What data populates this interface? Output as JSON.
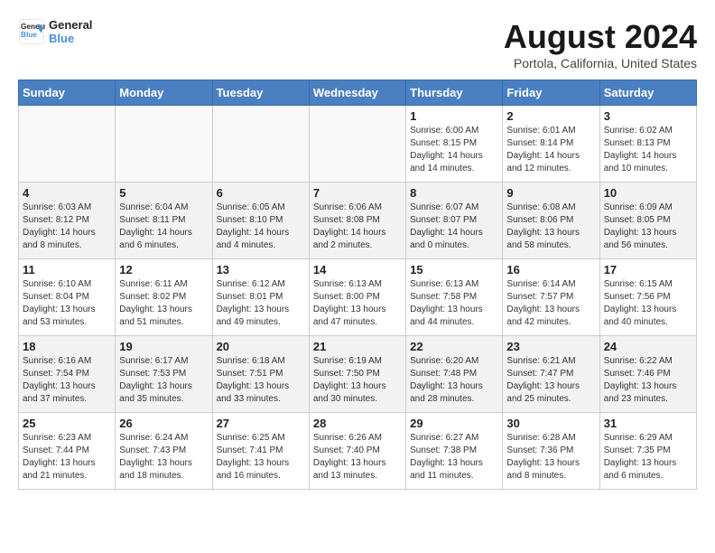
{
  "logo": {
    "line1": "General",
    "line2": "Blue"
  },
  "title": "August 2024",
  "location": "Portola, California, United States",
  "weekdays": [
    "Sunday",
    "Monday",
    "Tuesday",
    "Wednesday",
    "Thursday",
    "Friday",
    "Saturday"
  ],
  "weeks": [
    [
      {
        "day": "",
        "info": ""
      },
      {
        "day": "",
        "info": ""
      },
      {
        "day": "",
        "info": ""
      },
      {
        "day": "",
        "info": ""
      },
      {
        "day": "1",
        "info": "Sunrise: 6:00 AM\nSunset: 8:15 PM\nDaylight: 14 hours\nand 14 minutes."
      },
      {
        "day": "2",
        "info": "Sunrise: 6:01 AM\nSunset: 8:14 PM\nDaylight: 14 hours\nand 12 minutes."
      },
      {
        "day": "3",
        "info": "Sunrise: 6:02 AM\nSunset: 8:13 PM\nDaylight: 14 hours\nand 10 minutes."
      }
    ],
    [
      {
        "day": "4",
        "info": "Sunrise: 6:03 AM\nSunset: 8:12 PM\nDaylight: 14 hours\nand 8 minutes."
      },
      {
        "day": "5",
        "info": "Sunrise: 6:04 AM\nSunset: 8:11 PM\nDaylight: 14 hours\nand 6 minutes."
      },
      {
        "day": "6",
        "info": "Sunrise: 6:05 AM\nSunset: 8:10 PM\nDaylight: 14 hours\nand 4 minutes."
      },
      {
        "day": "7",
        "info": "Sunrise: 6:06 AM\nSunset: 8:08 PM\nDaylight: 14 hours\nand 2 minutes."
      },
      {
        "day": "8",
        "info": "Sunrise: 6:07 AM\nSunset: 8:07 PM\nDaylight: 14 hours\nand 0 minutes."
      },
      {
        "day": "9",
        "info": "Sunrise: 6:08 AM\nSunset: 8:06 PM\nDaylight: 13 hours\nand 58 minutes."
      },
      {
        "day": "10",
        "info": "Sunrise: 6:09 AM\nSunset: 8:05 PM\nDaylight: 13 hours\nand 56 minutes."
      }
    ],
    [
      {
        "day": "11",
        "info": "Sunrise: 6:10 AM\nSunset: 8:04 PM\nDaylight: 13 hours\nand 53 minutes."
      },
      {
        "day": "12",
        "info": "Sunrise: 6:11 AM\nSunset: 8:02 PM\nDaylight: 13 hours\nand 51 minutes."
      },
      {
        "day": "13",
        "info": "Sunrise: 6:12 AM\nSunset: 8:01 PM\nDaylight: 13 hours\nand 49 minutes."
      },
      {
        "day": "14",
        "info": "Sunrise: 6:13 AM\nSunset: 8:00 PM\nDaylight: 13 hours\nand 47 minutes."
      },
      {
        "day": "15",
        "info": "Sunrise: 6:13 AM\nSunset: 7:58 PM\nDaylight: 13 hours\nand 44 minutes."
      },
      {
        "day": "16",
        "info": "Sunrise: 6:14 AM\nSunset: 7:57 PM\nDaylight: 13 hours\nand 42 minutes."
      },
      {
        "day": "17",
        "info": "Sunrise: 6:15 AM\nSunset: 7:56 PM\nDaylight: 13 hours\nand 40 minutes."
      }
    ],
    [
      {
        "day": "18",
        "info": "Sunrise: 6:16 AM\nSunset: 7:54 PM\nDaylight: 13 hours\nand 37 minutes."
      },
      {
        "day": "19",
        "info": "Sunrise: 6:17 AM\nSunset: 7:53 PM\nDaylight: 13 hours\nand 35 minutes."
      },
      {
        "day": "20",
        "info": "Sunrise: 6:18 AM\nSunset: 7:51 PM\nDaylight: 13 hours\nand 33 minutes."
      },
      {
        "day": "21",
        "info": "Sunrise: 6:19 AM\nSunset: 7:50 PM\nDaylight: 13 hours\nand 30 minutes."
      },
      {
        "day": "22",
        "info": "Sunrise: 6:20 AM\nSunset: 7:48 PM\nDaylight: 13 hours\nand 28 minutes."
      },
      {
        "day": "23",
        "info": "Sunrise: 6:21 AM\nSunset: 7:47 PM\nDaylight: 13 hours\nand 25 minutes."
      },
      {
        "day": "24",
        "info": "Sunrise: 6:22 AM\nSunset: 7:46 PM\nDaylight: 13 hours\nand 23 minutes."
      }
    ],
    [
      {
        "day": "25",
        "info": "Sunrise: 6:23 AM\nSunset: 7:44 PM\nDaylight: 13 hours\nand 21 minutes."
      },
      {
        "day": "26",
        "info": "Sunrise: 6:24 AM\nSunset: 7:43 PM\nDaylight: 13 hours\nand 18 minutes."
      },
      {
        "day": "27",
        "info": "Sunrise: 6:25 AM\nSunset: 7:41 PM\nDaylight: 13 hours\nand 16 minutes."
      },
      {
        "day": "28",
        "info": "Sunrise: 6:26 AM\nSunset: 7:40 PM\nDaylight: 13 hours\nand 13 minutes."
      },
      {
        "day": "29",
        "info": "Sunrise: 6:27 AM\nSunset: 7:38 PM\nDaylight: 13 hours\nand 11 minutes."
      },
      {
        "day": "30",
        "info": "Sunrise: 6:28 AM\nSunset: 7:36 PM\nDaylight: 13 hours\nand 8 minutes."
      },
      {
        "day": "31",
        "info": "Sunrise: 6:29 AM\nSunset: 7:35 PM\nDaylight: 13 hours\nand 6 minutes."
      }
    ]
  ]
}
